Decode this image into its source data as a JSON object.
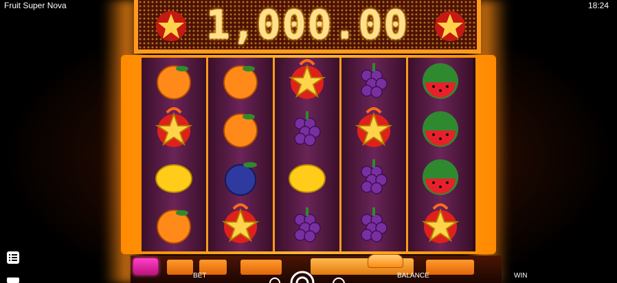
{
  "status_bar": {
    "app_title": "Fruit Super Nova",
    "time": "18:24"
  },
  "display": {
    "win_amount": "1,000.00"
  },
  "reels": [
    [
      "orange",
      "star",
      "lemon",
      "orange"
    ],
    [
      "orange",
      "orange",
      "plum",
      "star"
    ],
    [
      "star",
      "grapes",
      "lemon",
      "grapes"
    ],
    [
      "grapes",
      "star",
      "grapes",
      "grapes"
    ],
    [
      "watermelon",
      "watermelon",
      "watermelon",
      "star"
    ]
  ],
  "controls": {
    "bet_label": "BET",
    "balance_label": "BALANCE",
    "win_label": "WIN"
  },
  "icons": {
    "menu": "menu-list-icon",
    "star": "star-icon",
    "spin": "spin-icon"
  },
  "colors": {
    "accent_orange": "#ff9a1f",
    "reel_purple": "#6a2457",
    "highlight_pink": "#ff40c8"
  }
}
